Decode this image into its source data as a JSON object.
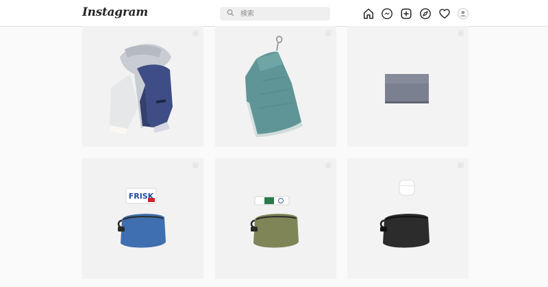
{
  "app": {
    "logo_text": "Instagram"
  },
  "search": {
    "placeholder": "検索"
  },
  "nav_icons": [
    "home-icon",
    "messenger-icon",
    "new-post-icon",
    "explore-icon",
    "activity-heart-icon",
    "profile-avatar"
  ],
  "colors": {
    "accent": "#262626",
    "border": "#dbdbdb",
    "background": "#fafafa"
  },
  "posts": [
    {
      "id": "post-1",
      "subject": "scarf"
    },
    {
      "id": "post-2",
      "subject": "towel"
    },
    {
      "id": "post-3",
      "subject": "card-case"
    },
    {
      "id": "post-4",
      "subject": "blue-pouch-frisk"
    },
    {
      "id": "post-5",
      "subject": "olive-pouch-gum"
    },
    {
      "id": "post-6",
      "subject": "black-pouch-airpods"
    }
  ],
  "frisk_label": "FRISK"
}
